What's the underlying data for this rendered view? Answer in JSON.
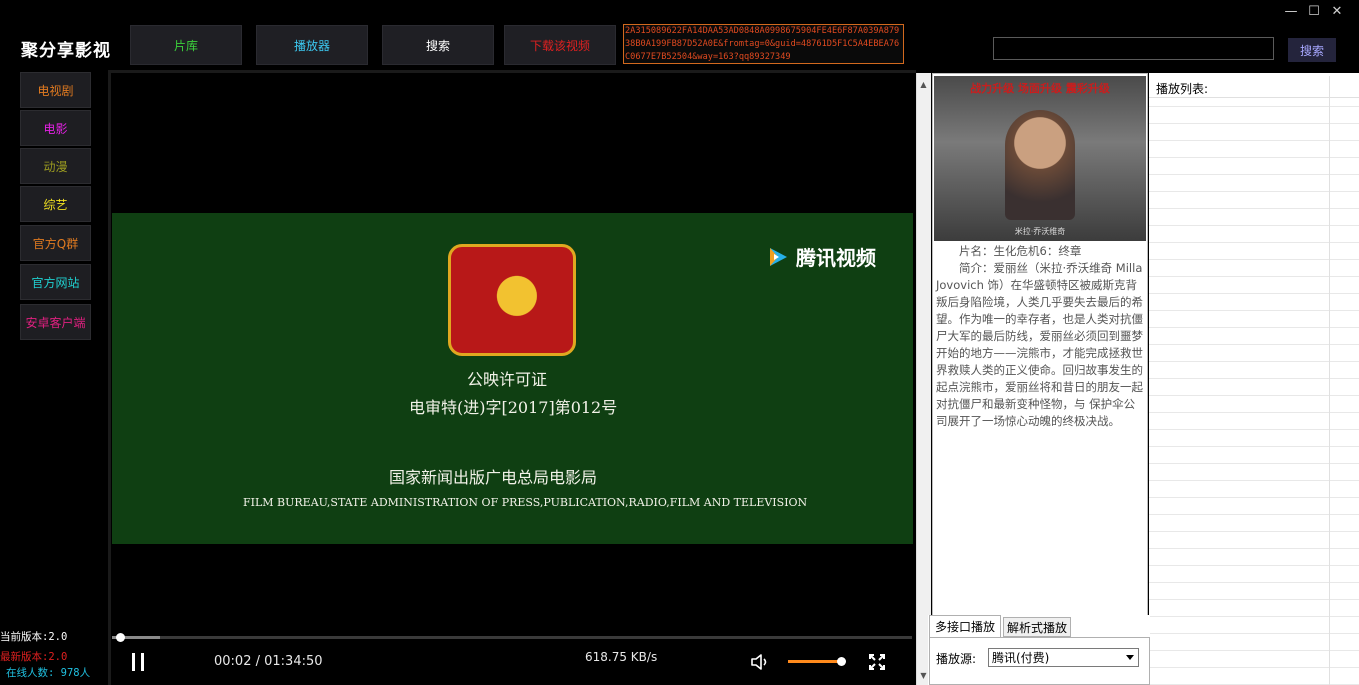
{
  "app": {
    "title": "聚分享影视"
  },
  "window_controls": {
    "minimize": "—",
    "maximize": "☐",
    "close": "✕"
  },
  "top_nav": {
    "items": [
      {
        "label": "片库",
        "color": "#3cd23c"
      },
      {
        "label": "播放器",
        "color": "#3cc8f0"
      },
      {
        "label": "搜索",
        "color": "#ffffff"
      },
      {
        "label": "下载该视频",
        "color": "#e02020"
      }
    ],
    "hash_text": "2A315089622FA14DAA53AD0848A0998675904FE4E6F87A039A87938B0A199FB87D52A0E&fromtag=0&guid=48761D5F1C5A4EBEA76C0677E7B52504&way=163?qq89327349"
  },
  "search": {
    "placeholder": "",
    "value": "",
    "button_label": "搜索"
  },
  "sidebar": {
    "items": [
      {
        "label": "电视剧",
        "color": "#e07a20"
      },
      {
        "label": "电影",
        "color": "#e020e0"
      },
      {
        "label": "动漫",
        "color": "#9a9a20"
      },
      {
        "label": "综艺",
        "color": "#f0e020"
      },
      {
        "label": "官方Q群",
        "color": "#e07a20"
      },
      {
        "label": "官方网站",
        "color": "#20d0d0"
      },
      {
        "label": "安卓客户端",
        "color": "#e02080"
      }
    ],
    "version_current": "当前版本:2.0",
    "version_latest": "最新版本:2.0",
    "online_count": "在线人数: 978人"
  },
  "video": {
    "license_title": "公映许可证",
    "license_number": "电审特(进)字[2017]第012号",
    "bureau_cn": "国家新闻出版广电总局电影局",
    "bureau_en": "FILM BUREAU,STATE ADMINISTRATION OF PRESS,PUBLICATION,RADIO,FILM AND TELEVISION",
    "watermark": "腾讯视频"
  },
  "player": {
    "current_time": "00:02",
    "total_time": "01:34:50",
    "time_separator": " / ",
    "speed": "618.75 KB/s",
    "progress_fraction": 0.06,
    "volume_fraction": 1.0
  },
  "info": {
    "poster_tagline": "战力升级 场面升级 震彩升级",
    "poster_caption": "米拉·乔沃维奇",
    "title_line": "片名：生化危机6：终章",
    "description": "简介：爱丽丝（米拉·乔沃维奇 Milla Jovovich 饰）在华盛顿特区被威斯克背叛后身陷险境，人类几乎要失去最后的希望。作为唯一的幸存者，也是人类对抗僵尸大军的最后防线，爱丽丝必须回到噩梦开始的地方——浣熊市，才能完成拯救世界救赎人类的正义使命。回归故事发生的起点浣熊市，爱丽丝将和昔日的朋友一起对抗僵尸和最新变种怪物，与 保护伞公司展开了一场惊心动魄的终极决战。"
  },
  "playlist": {
    "title": "播放列表:"
  },
  "source_tabs": {
    "tabs": [
      "多接口播放",
      "解析式播放"
    ],
    "source_label": "播放源:",
    "source_value": "腾讯(付费)"
  }
}
